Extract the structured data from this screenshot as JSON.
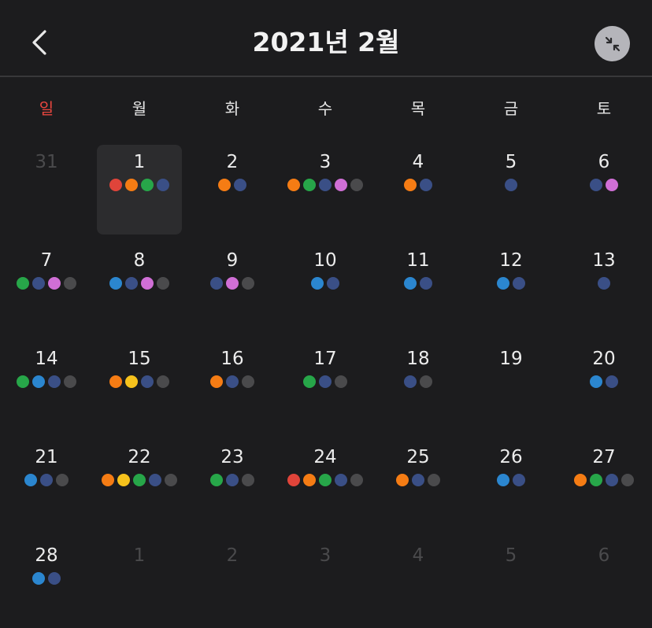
{
  "header": {
    "title": "2021년 2월",
    "back_icon": "chevron-left-icon",
    "collapse_icon": "collapse-arrows-icon"
  },
  "weekdays": [
    "일",
    "월",
    "화",
    "수",
    "목",
    "금",
    "토"
  ],
  "colors": {
    "red": "#e0443a",
    "orange": "#f57c14",
    "green": "#27a649",
    "blue": "#2b86cf",
    "navy": "#3a4f86",
    "purple": "#d06fd6",
    "yellow": "#f6c21c",
    "gray": "#4a4a4c",
    "sunday_label": "#e8463f",
    "selected_bg": "#2c2c2e"
  },
  "weeks": [
    [
      {
        "day": "31",
        "muted": true,
        "dots": []
      },
      {
        "day": "1",
        "selected": true,
        "dots": [
          "red",
          "orange",
          "green",
          "navy"
        ]
      },
      {
        "day": "2",
        "dots": [
          "orange",
          "navy"
        ]
      },
      {
        "day": "3",
        "dots": [
          "orange",
          "green",
          "navy",
          "purple",
          "gray"
        ]
      },
      {
        "day": "4",
        "dots": [
          "orange",
          "navy"
        ]
      },
      {
        "day": "5",
        "dots": [
          "navy"
        ]
      },
      {
        "day": "6",
        "dots": [
          "navy",
          "purple"
        ]
      }
    ],
    [
      {
        "day": "7",
        "dots": [
          "green",
          "navy",
          "purple",
          "gray"
        ]
      },
      {
        "day": "8",
        "dots": [
          "blue",
          "navy",
          "purple",
          "gray"
        ]
      },
      {
        "day": "9",
        "dots": [
          "navy",
          "purple",
          "gray"
        ]
      },
      {
        "day": "10",
        "dots": [
          "blue",
          "navy"
        ]
      },
      {
        "day": "11",
        "dots": [
          "blue",
          "navy"
        ]
      },
      {
        "day": "12",
        "dots": [
          "blue",
          "navy"
        ]
      },
      {
        "day": "13",
        "dots": [
          "navy"
        ]
      }
    ],
    [
      {
        "day": "14",
        "dots": [
          "green",
          "blue",
          "navy",
          "gray"
        ]
      },
      {
        "day": "15",
        "dots": [
          "orange",
          "yellow",
          "navy",
          "gray"
        ]
      },
      {
        "day": "16",
        "dots": [
          "orange",
          "navy",
          "gray"
        ]
      },
      {
        "day": "17",
        "dots": [
          "green",
          "navy",
          "gray"
        ]
      },
      {
        "day": "18",
        "dots": [
          "navy",
          "gray"
        ]
      },
      {
        "day": "19",
        "dots": []
      },
      {
        "day": "20",
        "dots": [
          "blue",
          "navy"
        ]
      }
    ],
    [
      {
        "day": "21",
        "dots": [
          "blue",
          "navy",
          "gray"
        ]
      },
      {
        "day": "22",
        "dots": [
          "orange",
          "yellow",
          "green",
          "navy",
          "gray"
        ]
      },
      {
        "day": "23",
        "dots": [
          "green",
          "navy",
          "gray"
        ]
      },
      {
        "day": "24",
        "dots": [
          "red",
          "orange",
          "green",
          "navy",
          "gray"
        ]
      },
      {
        "day": "25",
        "dots": [
          "orange",
          "navy",
          "gray"
        ]
      },
      {
        "day": "26",
        "dots": [
          "blue",
          "navy"
        ]
      },
      {
        "day": "27",
        "dots": [
          "orange",
          "green",
          "navy",
          "gray"
        ]
      }
    ],
    [
      {
        "day": "28",
        "dots": [
          "blue",
          "navy"
        ]
      },
      {
        "day": "1",
        "muted": true,
        "dots": []
      },
      {
        "day": "2",
        "muted": true,
        "dots": []
      },
      {
        "day": "3",
        "muted": true,
        "dots": []
      },
      {
        "day": "4",
        "muted": true,
        "dots": []
      },
      {
        "day": "5",
        "muted": true,
        "dots": []
      },
      {
        "day": "6",
        "muted": true,
        "dots": []
      }
    ]
  ]
}
